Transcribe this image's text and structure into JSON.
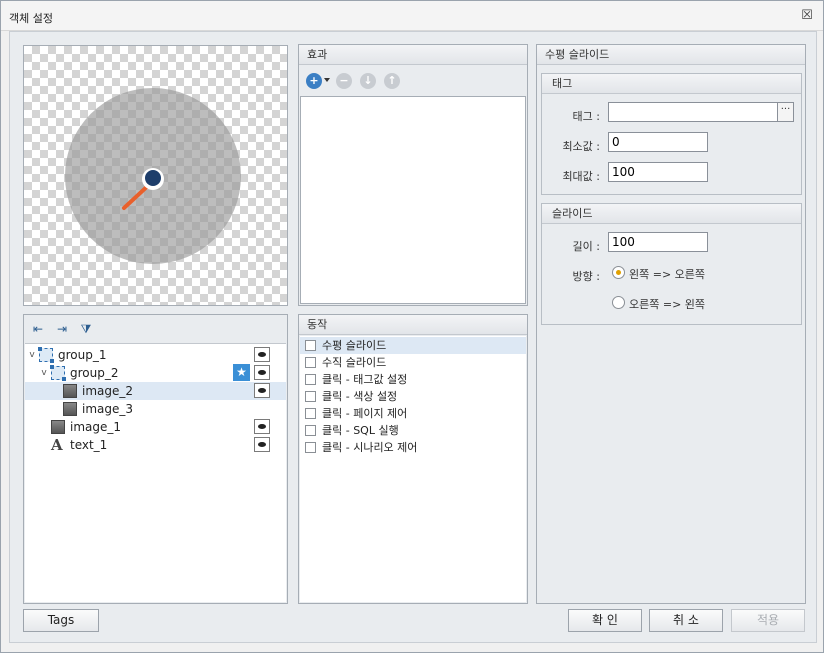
{
  "window": {
    "title": "객체 설정",
    "close_glyph": "☒"
  },
  "effects_panel": {
    "title": "효과",
    "toolbar": [
      "add-icon",
      "remove-icon",
      "move-down-icon",
      "move-up-icon"
    ]
  },
  "actions_panel": {
    "title": "동작",
    "items": [
      "수평 슬라이드",
      "수직 슬라이드",
      "클릭 - 태그값 설정",
      "클릭 - 색상 설정",
      "클릭 - 페이지 제어",
      "클릭 - SQL 실행",
      "클릭 - 시나리오 제어"
    ]
  },
  "tree": {
    "toolbar": [
      "outdent-icon",
      "indent-icon",
      "filter-clear-icon"
    ],
    "nodes": [
      {
        "label": "group_1"
      },
      {
        "label": "group_2"
      },
      {
        "label": "image_2"
      },
      {
        "label": "image_3"
      },
      {
        "label": "image_1"
      },
      {
        "label": "text_1"
      }
    ]
  },
  "props": {
    "title": "수평 슬라이드",
    "tag_group": {
      "title": "태그",
      "tag_label": "태그 :",
      "tag_value": "",
      "ellipsis": "···",
      "min_label": "최소값 :",
      "min_value": "0",
      "max_label": "최대값 :",
      "max_value": "100"
    },
    "slide_group": {
      "title": "슬라이드",
      "length_label": "길이 :",
      "length_value": "100",
      "direction_label": "방향 :",
      "option_ltr": "왼쪽 => 오른쪽",
      "option_rtl": "오른쪽 => 왼쪽"
    }
  },
  "buttons": {
    "tags": "Tags",
    "ok": "확 인",
    "cancel": "취 소",
    "apply": "적용"
  },
  "colors": {
    "accent": "#3b7fc4",
    "needle": "#e8602c",
    "knob": "#1e3e6b",
    "radio_selected": "#e0a000"
  }
}
